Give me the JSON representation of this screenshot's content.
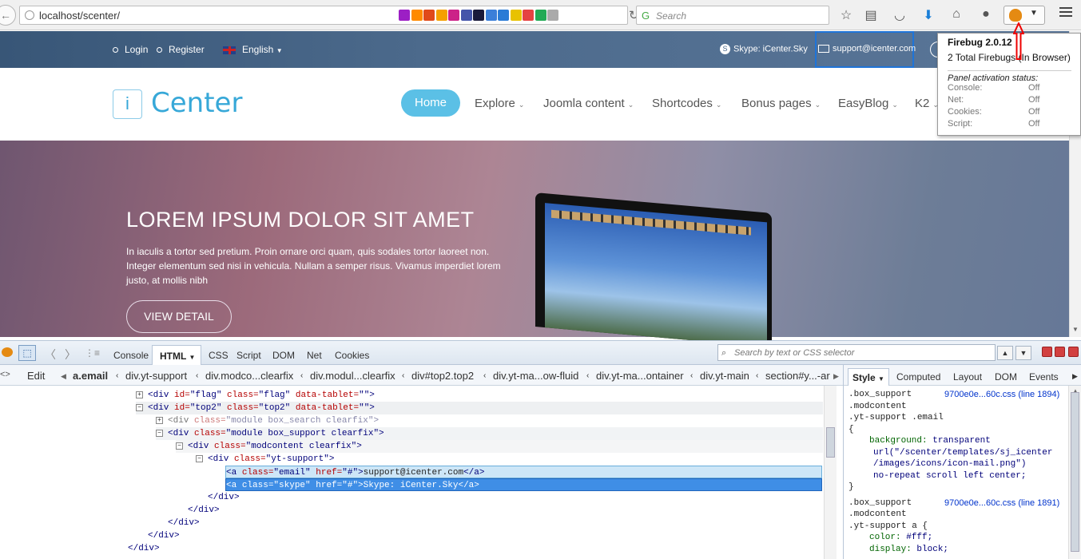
{
  "browser": {
    "url": "localhost/scenter/",
    "search_placeholder": "Search",
    "back_glyph": "←",
    "reload_glyph": "↻",
    "addons": [
      "#9c1fc4",
      "#ff8a00",
      "#e04a1a",
      "#f5a000",
      "#cc2288",
      "#4455aa",
      "#1a1a3a",
      "#3b7fd9",
      "#2a7bd6",
      "#e8c200",
      "#e54242",
      "#22aa55",
      "#aaaaaa"
    ],
    "icons": [
      "bookmark-star-icon",
      "reading-list-icon",
      "pocket-icon",
      "download-icon",
      "home-icon",
      "chat-icon"
    ]
  },
  "site": {
    "top_links": {
      "login": "Login",
      "register": "Register",
      "language": "English"
    },
    "skype": "Skype: iCenter.Sky",
    "email": "support@icenter.com",
    "logo_i": "i",
    "logo_text": "Center",
    "nav": {
      "home": "Home",
      "explore": "Explore",
      "joomla": "Joomla content",
      "shortcodes": "Shortcodes",
      "bonus": "Bonus pages",
      "easyblog": "EasyBlog",
      "k2": "K2"
    },
    "hero": {
      "title": "LOREM IPSUM DOLOR SIT AMET",
      "text": "In iaculis a tortor sed pretium. Proin ornare orci quam, quis sodales tortor laoreet non. Integer elementum sed nisi in vehicula. Nullam a semper risus. Vivamus imperdiet lorem justo, at mollis nibh",
      "button": "VIEW DETAIL"
    }
  },
  "popup": {
    "title": "Firebug 2.0.12",
    "subtitle": "2 Total Firebugs (In Browser)",
    "panel_heading": "Panel activation status:",
    "rows": [
      {
        "name": "Console:",
        "value": "Off"
      },
      {
        "name": "Net:",
        "value": "Off"
      },
      {
        "name": "Cookies:",
        "value": "Off"
      },
      {
        "name": "Script:",
        "value": "Off"
      }
    ]
  },
  "firebug": {
    "tabs": {
      "console": "Console",
      "html": "HTML",
      "css": "CSS",
      "script": "Script",
      "dom": "DOM",
      "net": "Net",
      "cookies": "Cookies"
    },
    "search_placeholder": "Search by text or CSS selector",
    "edit": "Edit",
    "breadcrumbs": [
      "a.email",
      "div.yt-support",
      "div.modco...clearfix",
      "div.modul...clearfix",
      "div#top2.top2",
      "div.yt-ma...ow-fluid",
      "div.yt-ma...ontainer",
      "div.yt-main",
      "section#y...-ar"
    ],
    "html_lines": [
      {
        "t": "<div ",
        "a": "id=",
        "v": "\"flag\"",
        "a2": " class=",
        "v2": "\"flag\"",
        "a3": " data-tablet=",
        "v3": "\"\">"
      },
      {
        "t": "<div ",
        "a": "id=",
        "v": "\"top2\"",
        "a2": " class=",
        "v2": "\"top2\"",
        "a3": " data-tablet=",
        "v3": "\"\">"
      },
      {
        "t": "<div ",
        "a": "class=",
        "v": "\"module box_search clearfix\">"
      },
      {
        "t": "<div ",
        "a": "class=",
        "v": "\"module box_support clearfix\">"
      },
      {
        "t": "<div ",
        "a": "class=",
        "v": "\"modcontent clearfix\">"
      },
      {
        "t": "<div ",
        "a": "class=",
        "v": "\"yt-support\">"
      },
      {
        "t": "<a ",
        "a": "class=",
        "v": "\"email\"",
        "a2": " href=",
        "v2": "\"#\">",
        "text": "support@icenter.com",
        "end": "</a>"
      },
      {
        "t": "<a ",
        "a": "class=",
        "v": "\"skype\"",
        "a2": " href=",
        "v2": "\"#\">",
        "text": "Skype: iCenter.Sky",
        "end": "</a>"
      },
      {
        "t": "</div>"
      },
      {
        "t": "</div>"
      },
      {
        "t": "</div>"
      },
      {
        "t": "</div>"
      },
      {
        "t": "</div>"
      }
    ],
    "side_tabs": {
      "style": "Style",
      "computed": "Computed",
      "layout": "Layout",
      "dom": "DOM",
      "events": "Events"
    },
    "css": {
      "r1_sel1": ".box_support",
      "r1_src": "9700e0e...60c.css (line 1894)",
      "r1_sel2": ".modcontent",
      "r1_sel3": ".yt-support .email",
      "open": "{",
      "close": "}",
      "r1_prop": "background:",
      "r1_v1": "transparent",
      "r1_v2": "url(\"/scenter/templates/sj_icenter",
      "r1_v3": "/images/icons/icon-mail.png\")",
      "r1_v4": "no-repeat scroll left center;",
      "r2_sel1": ".box_support",
      "r2_src": "9700e0e...60c.css (line 1891)",
      "r2_sel2": ".modcontent",
      "r2_sel3": ".yt-support a {",
      "r2_p1": "color:",
      "r2_v1": "#fff;",
      "r2_p2": "display:",
      "r2_v2": "block;"
    }
  }
}
